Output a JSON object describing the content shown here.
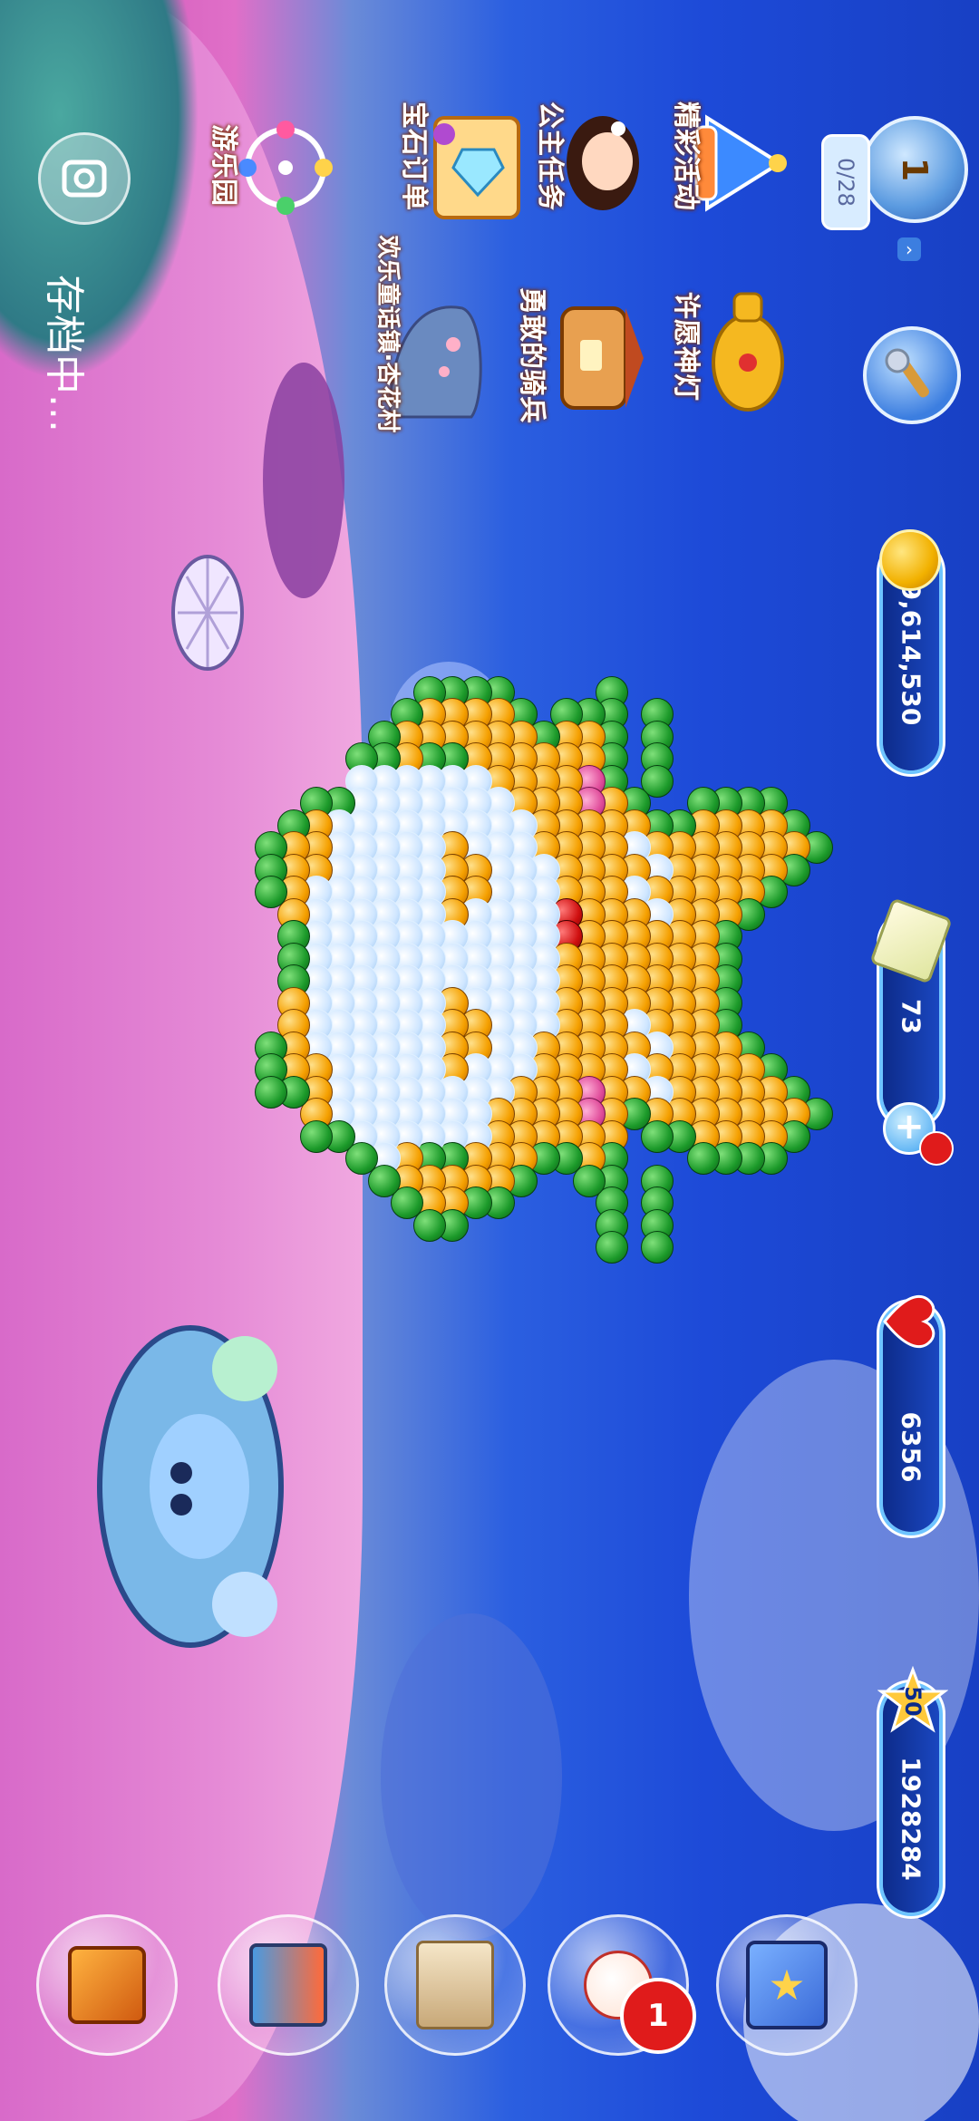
{
  "hud": {
    "level_value": "1",
    "level_progress": "0/28",
    "coins": "9,614,530",
    "gifts": "73",
    "hearts": "6356",
    "stars_badge": "50",
    "stars_total": "1928284"
  },
  "features": {
    "activity": "精彩活动",
    "princess_task": "公主任务",
    "gem_order": "宝石订单",
    "amusement_park": "游乐园",
    "wish_lamp": "许愿神灯",
    "brave_knight": "勇敢的骑兵",
    "fairy_village": "欢乐童话镇·杏花村"
  },
  "status": {
    "saving_text": "存档中..."
  },
  "bottom_buttons": {
    "character_badge": "1"
  },
  "colors": {
    "coin_gold": "#f2b100",
    "heart_red": "#e01b1b",
    "ball_green": "#1c9a2a",
    "ball_orange": "#f5a000"
  },
  "puzzle": {
    "rows": [
      "............G...........G.....",
      "...........GOG.........GOG....",
      "..........GOOOG.......GOOOG...",
      "..........GOOOOG.....GOOOOG...",
      "..........GOOOOOGGGGGOOOOOG...",
      "..........GOOOOOOOOOOOOOOOG...",
      "...........GOOOOOOOOOOOOOG....",
      "......GGGG.GOWOWOOOOOWOWOG.GGGG",
      "..........GOWOWOOOOOWOWOG.....",
      ".....GGGGGOOOOOOOOOOOOOOOOGGGGG",
      "......GOOPPOOOOOOOOOOOOPPOOG...",
      "......GOOOOOOOORROOOOOOOOOG....",
      ".......GOOOOOWWWWWWWWOOOOOG....",
      "......GOOOOWWWWWWWWWWWWOOOOG...",
      ".....GOOOOWWWWWWWWWWWWWWOOOOG..",
      ".....GOOOWWWWOOWWWWWOOWWWWOOG..",
      ".....GOOGWWWOOOOWWWOOOOWWWGOOG.",
      ".....GOOGWWWWWWWWWWWWWWWWWGOOG.",
      "......GOOWWWWWWWWWWWWWWWWWOOG..",
      ".......GGWWWWWWWWWWWWWWWWWWG...",
      "........GWWWWWWWWWWWWWWWWWG....",
      "..........GWWWWWWWWWWWWWWG.....",
      "..........GOOOWWWWWWWWOOOG.....",
      "...........GOOOOGGGOOOOG......",
      "............GGG......GGG......"
    ]
  }
}
